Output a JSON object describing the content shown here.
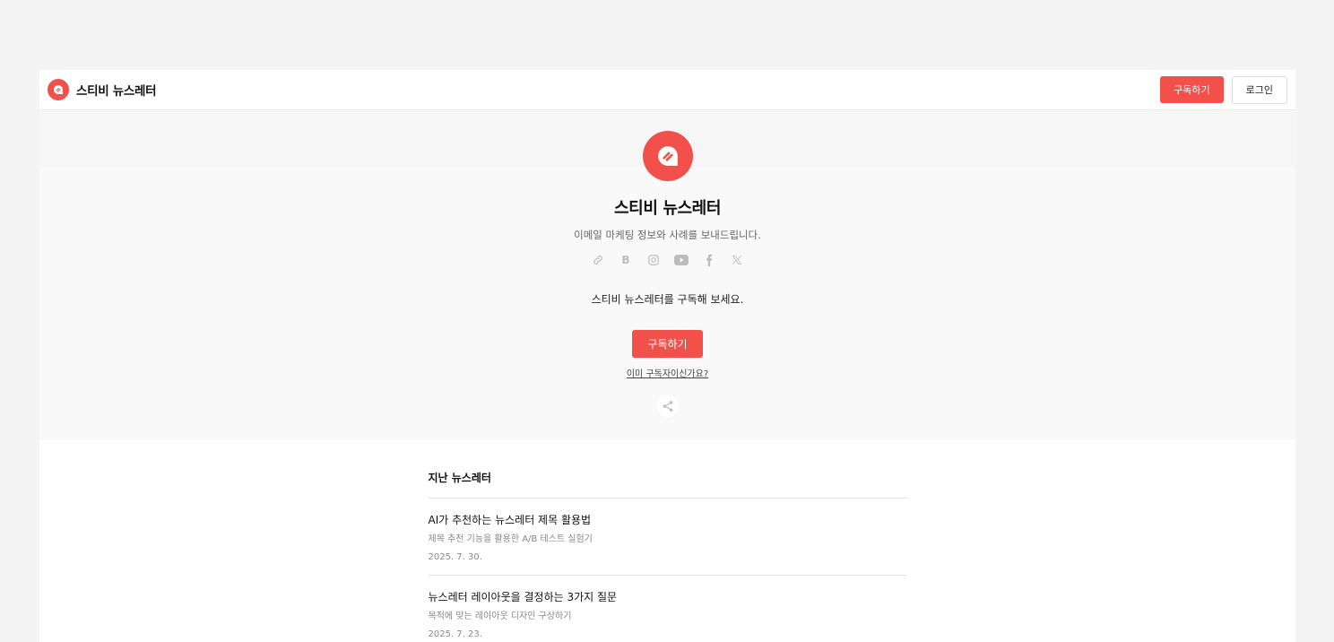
{
  "header": {
    "brand_name": "스티비 뉴스레터",
    "subscribe_label": "구독하기",
    "login_label": "로그인"
  },
  "hero": {
    "title": "스티비 뉴스레터",
    "description": "이메일 마케팅 정보와 사례를 보내드립니다.",
    "social_icons": [
      "link-icon",
      "blog-icon",
      "instagram-icon",
      "youtube-icon",
      "facebook-icon",
      "x-icon"
    ],
    "blog_glyph": "B",
    "cta_text": "스티비 뉴스레터를 구독해 보세요.",
    "subscribe_label": "구독하기",
    "already_subscribed": "이미 구독자이신가요?"
  },
  "archive": {
    "title": "지난 뉴스레터",
    "posts": [
      {
        "title": "AI가 추천하는 뉴스레터 제목 활용법",
        "subtitle": "제목 추천 기능을 활용한 A/B 테스트 실험기",
        "date": "2025. 7. 30."
      },
      {
        "title": "뉴스레터 레이아웃을 결정하는 3가지 질문",
        "subtitle": "목적에 맞는 레이아웃 디자인 구상하기",
        "date": "2025. 7. 23."
      }
    ]
  },
  "colors": {
    "accent": "#f2504b",
    "background": "#f4f4f4",
    "hero_background": "#f9f9f9"
  }
}
